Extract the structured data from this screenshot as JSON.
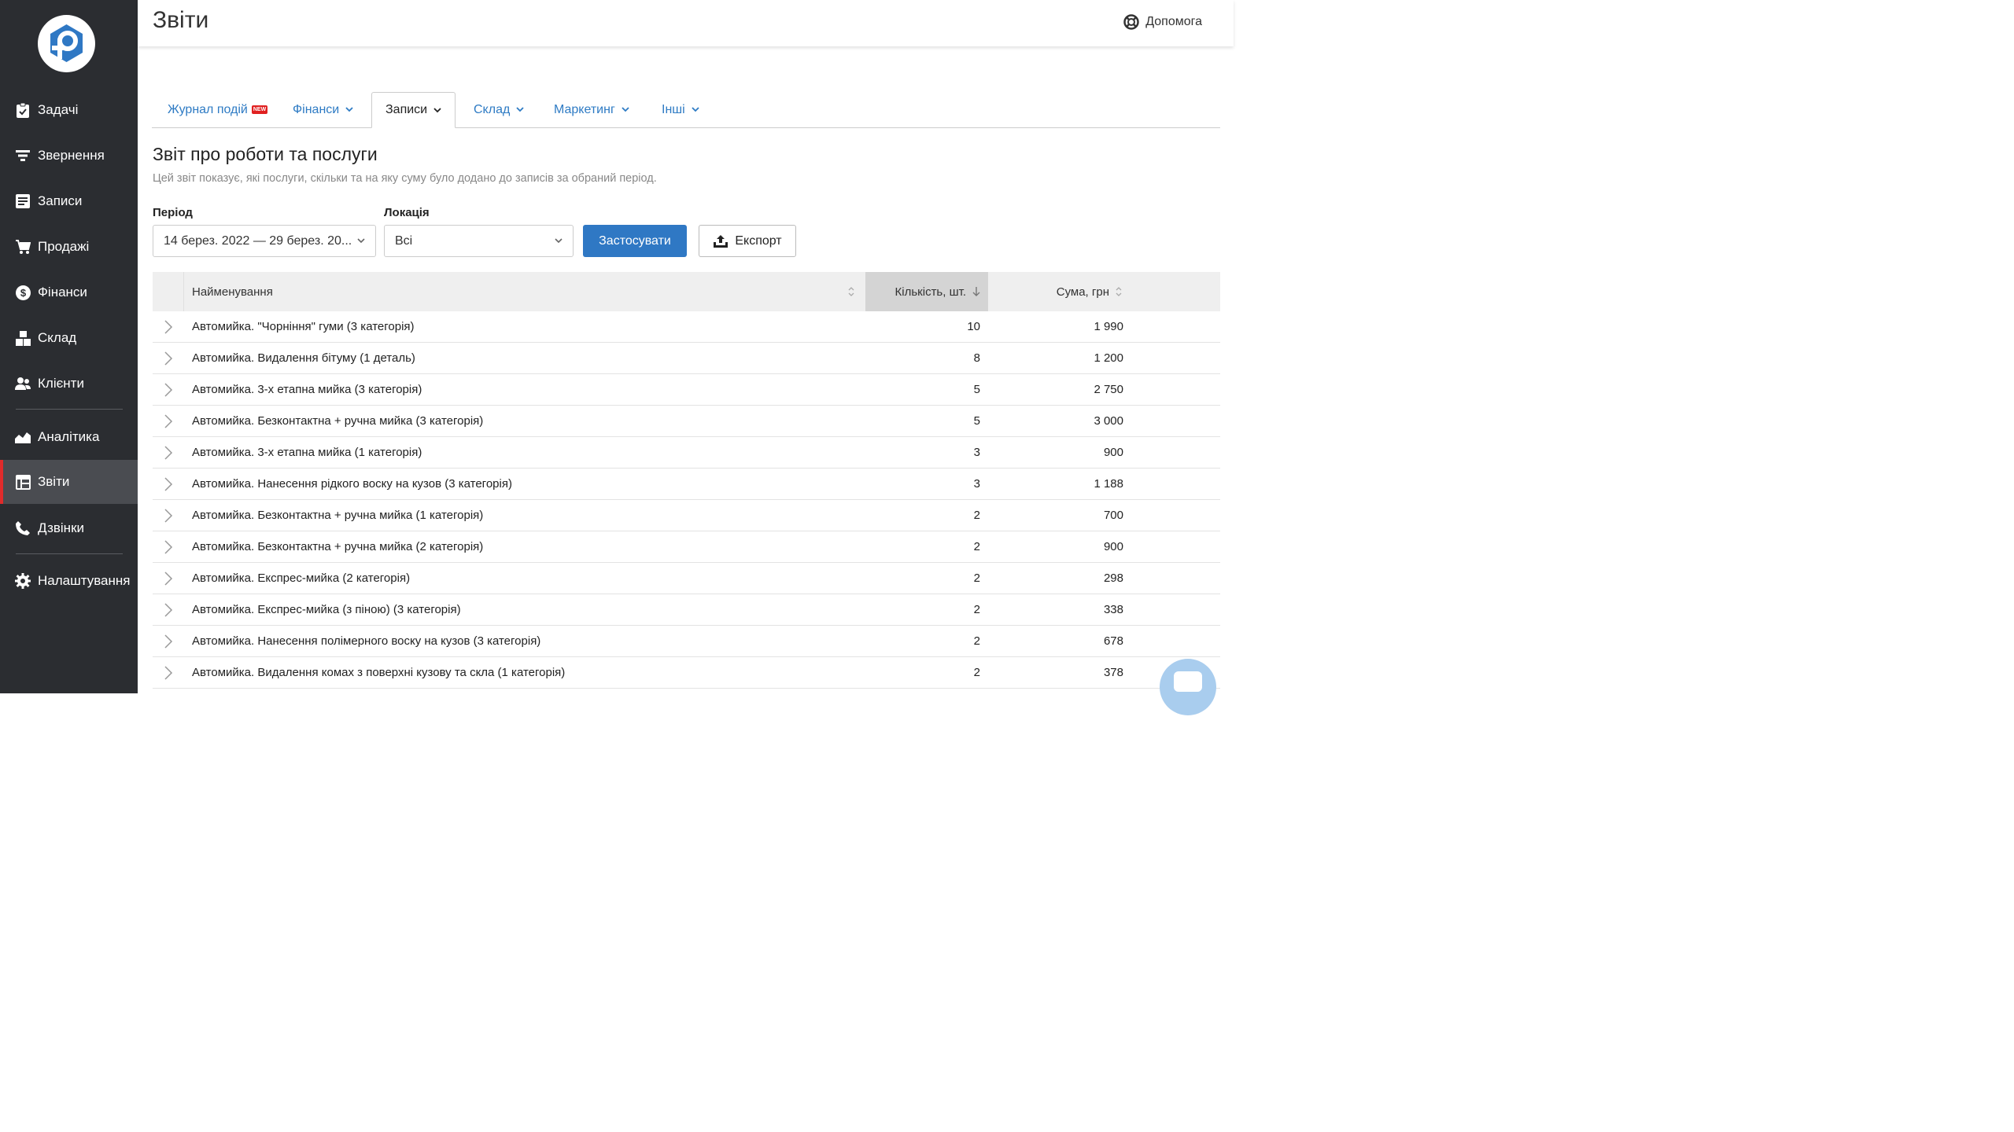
{
  "sidebar": {
    "logo_icon": "parking-p-logo",
    "items": [
      {
        "label": "Задачі",
        "icon": "clipboard-check-icon"
      },
      {
        "label": "Звернення",
        "icon": "filter-icon"
      },
      {
        "label": "Записи",
        "icon": "notes-icon"
      },
      {
        "label": "Продажі",
        "icon": "cart-icon"
      },
      {
        "label": "Фінанси",
        "icon": "dollar-icon"
      },
      {
        "label": "Склад",
        "icon": "boxes-icon"
      },
      {
        "label": "Клієнти",
        "icon": "users-icon"
      },
      {
        "label": "Аналітика",
        "icon": "chart-area-icon"
      },
      {
        "label": "Звіти",
        "icon": "table-icon",
        "active": true
      },
      {
        "label": "Дзвінки",
        "icon": "phone-icon"
      },
      {
        "label": "Налаштування",
        "icon": "gear-icon"
      }
    ]
  },
  "header": {
    "title": "Звіти",
    "help_label": "Допомога"
  },
  "tabs": [
    {
      "label": "Журнал подій",
      "badge": "NEW"
    },
    {
      "label": "Фінанси"
    },
    {
      "label": "Записи",
      "active": true
    },
    {
      "label": "Склад"
    },
    {
      "label": "Маркетинг"
    },
    {
      "label": "Інші"
    }
  ],
  "report": {
    "title": "Звіт про роботи та послуги",
    "description": "Цей звіт показує, які послуги, скільки та на яку суму було додано до записів за обраний період."
  },
  "filters": {
    "period_label": "Період",
    "period_value": "14 берез. 2022 — 29 берез. 20...",
    "location_label": "Локація",
    "location_value": "Всі",
    "apply_label": "Застосувати",
    "export_label": "Експорт"
  },
  "table": {
    "columns": [
      "Найменування",
      "Кількість, шт.",
      "Сума, грн"
    ],
    "rows": [
      {
        "name": "Автомийка. \"Чорніння\" гуми (3 категорія)",
        "qty": "10",
        "sum": "1 990"
      },
      {
        "name": "Автомийка. Видалення бітуму (1 деталь)",
        "qty": "8",
        "sum": "1 200"
      },
      {
        "name": "Автомийка. 3-х етапна мийка (3 категорія)",
        "qty": "5",
        "sum": "2 750"
      },
      {
        "name": "Автомийка. Безконтактна + ручна мийка (3 категорія)",
        "qty": "5",
        "sum": "3 000"
      },
      {
        "name": "Автомийка. 3-х етапна мийка (1 категорія)",
        "qty": "3",
        "sum": "900"
      },
      {
        "name": "Автомийка. Нанесення рідкого воску на кузов (3 категорія)",
        "qty": "3",
        "sum": "1 188"
      },
      {
        "name": "Автомийка. Безконтактна + ручна мийка (1 категорія)",
        "qty": "2",
        "sum": "700"
      },
      {
        "name": "Автомийка. Безконтактна + ручна мийка (2 категорія)",
        "qty": "2",
        "sum": "900"
      },
      {
        "name": "Автомийка. Експрес-мийка (2 категорія)",
        "qty": "2",
        "sum": "298"
      },
      {
        "name": "Автомийка. Експрес-мийка (з піною) (3 категорія)",
        "qty": "2",
        "sum": "338"
      },
      {
        "name": "Автомийка. Нанесення полімерного воску на кузов (3 категорія)",
        "qty": "2",
        "sum": "678"
      },
      {
        "name": "Автомийка. Видалення комах з поверхні кузову та скла (1 категорія)",
        "qty": "2",
        "sum": "378"
      }
    ]
  },
  "colors": {
    "sidebar_bg": "#2b2d31",
    "active_item_bg": "#4a4c51",
    "active_marker": "#e02b2b",
    "link_blue": "#2e7bc4",
    "primary_button": "#2f78c4"
  }
}
